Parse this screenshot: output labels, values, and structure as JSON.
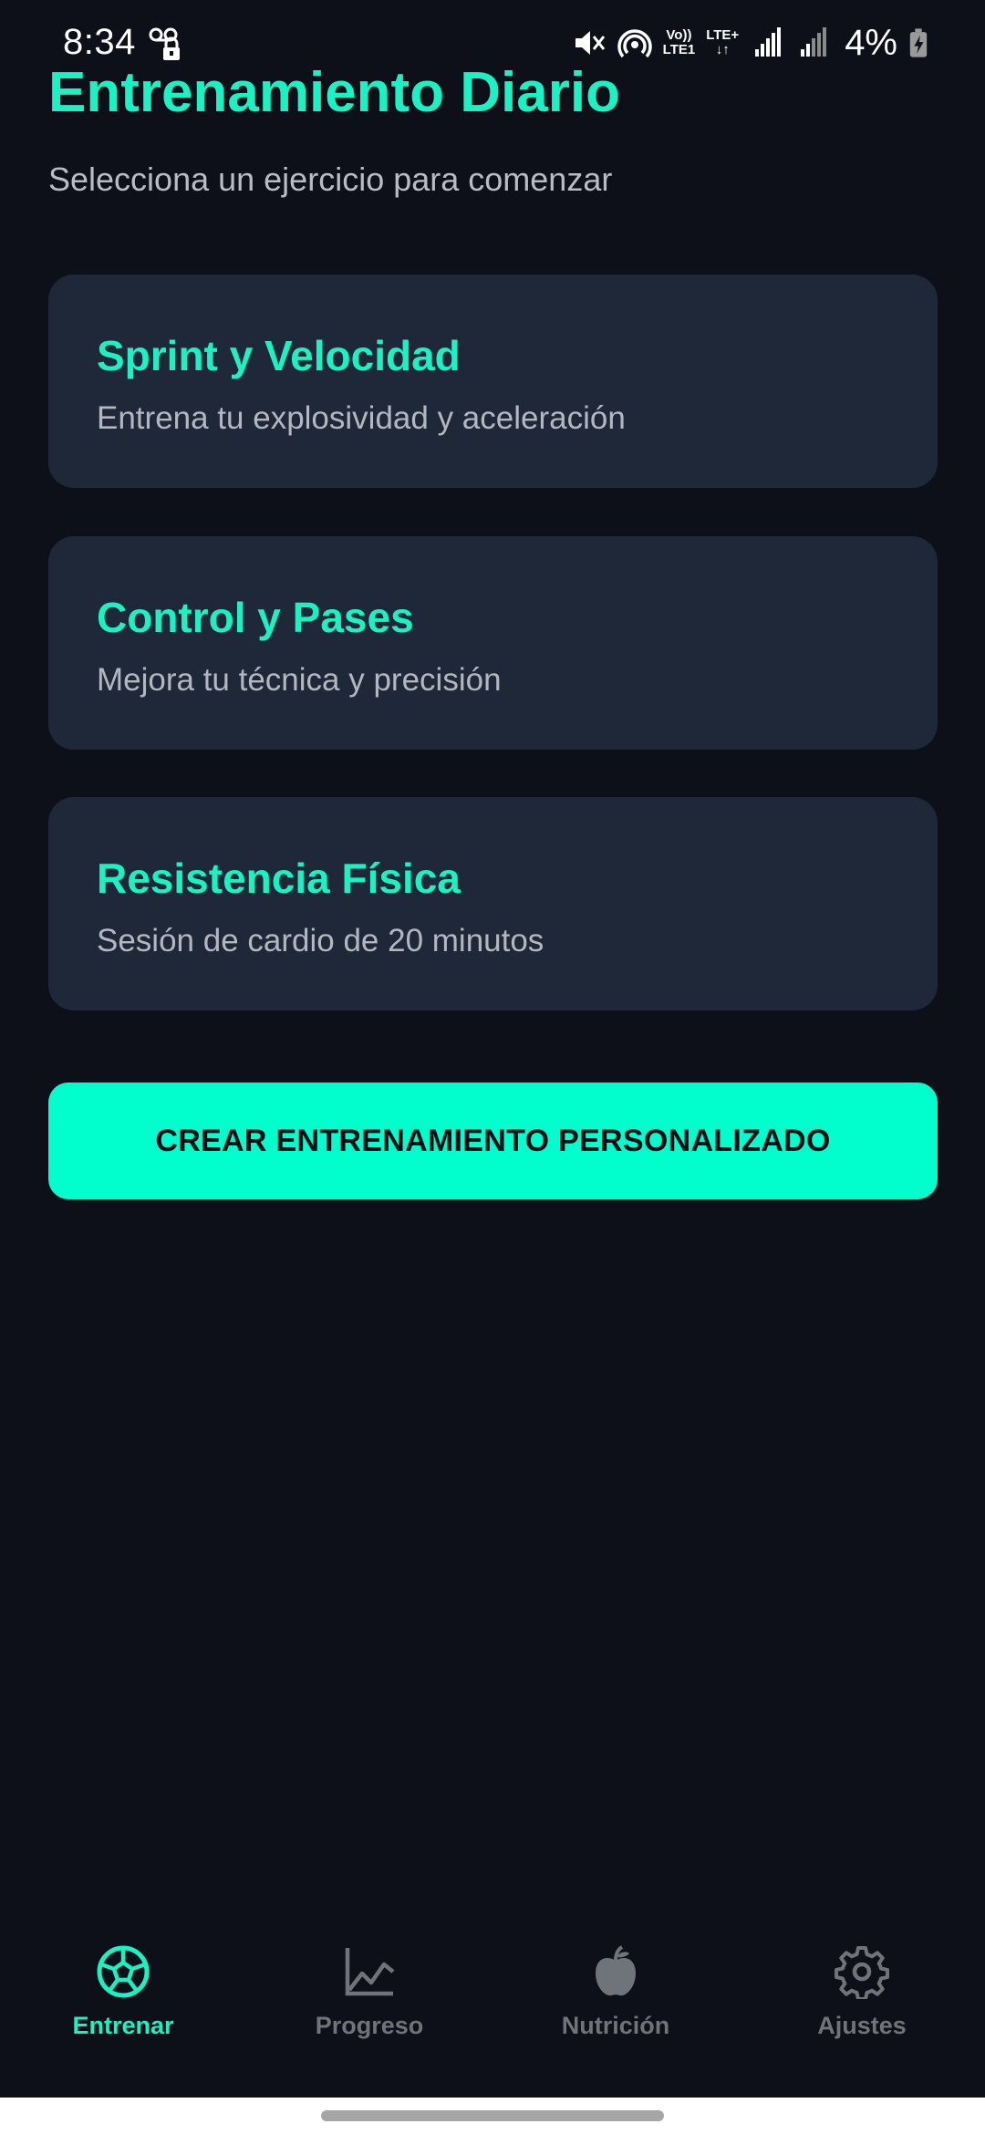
{
  "status_bar": {
    "time": "8:34",
    "network_top": "Vo))",
    "network_bottom": "LTE1",
    "lte_label": "LTE+",
    "battery_percent": "4%",
    "icons": [
      "voicemail-lock-icon",
      "mute-icon",
      "hotspot-icon",
      "signal-icon",
      "signal-icon",
      "battery-charging-icon"
    ]
  },
  "header": {
    "title": "Entrenamiento Diario",
    "subtitle": "Selecciona un ejercicio para comenzar"
  },
  "workouts": [
    {
      "title": "Sprint y Velocidad",
      "description": "Entrena tu explosividad y aceleración"
    },
    {
      "title": "Control y Pases",
      "description": "Mejora tu técnica y precisión"
    },
    {
      "title": "Resistencia Física",
      "description": "Sesión de cardio de 20 minutos"
    }
  ],
  "cta": {
    "label": "CREAR ENTRENAMIENTO PERSONALIZADO"
  },
  "bottom_nav": {
    "items": [
      {
        "label": "Entrenar",
        "icon": "soccer-ball-icon",
        "active": true
      },
      {
        "label": "Progreso",
        "icon": "line-chart-icon",
        "active": false
      },
      {
        "label": "Nutrición",
        "icon": "apple-icon",
        "active": false
      },
      {
        "label": "Ajustes",
        "icon": "gear-icon",
        "active": false
      }
    ]
  },
  "colors": {
    "background": "#0d1018",
    "card": "#1e2838",
    "accent": "#19f2c3",
    "button": "#00ffcc",
    "inactive": "#6f737a"
  }
}
